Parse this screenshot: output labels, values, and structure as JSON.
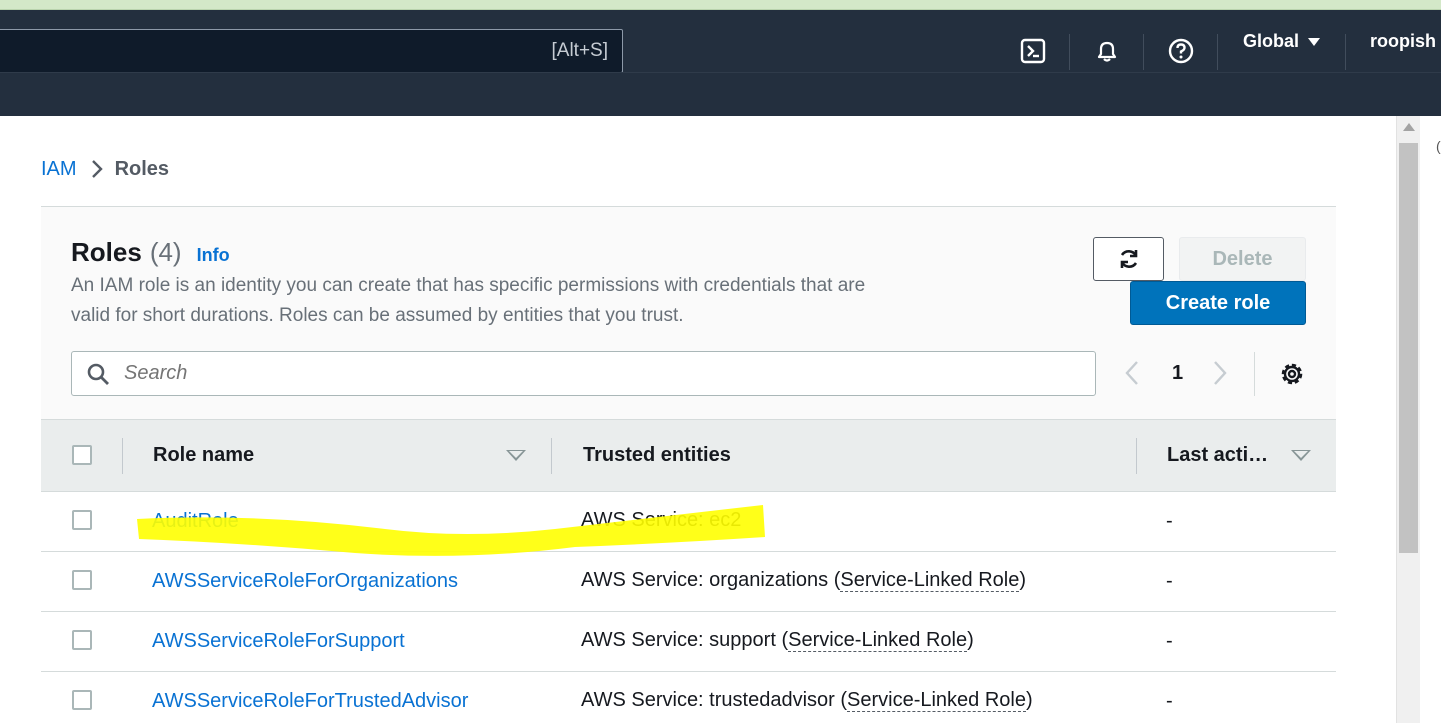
{
  "topnav": {
    "search_shortcut": "[Alt+S]",
    "region": "Global",
    "user": "roopish",
    "icons": [
      "cloudshell-icon",
      "notifications-bell-icon",
      "help-icon"
    ]
  },
  "breadcrumb": {
    "root": "IAM",
    "current": "Roles"
  },
  "roles_panel": {
    "title": "Roles",
    "count": "(4)",
    "info": "Info",
    "description": "An IAM role is an identity you can create that has specific permissions with credentials that are valid for short durations. Roles can be assumed by entities that you trust.",
    "delete_label": "Delete",
    "create_label": "Create role",
    "search_placeholder": "Search",
    "page": "1"
  },
  "table": {
    "columns": [
      "Role name",
      "Trusted entities",
      "Last acti…"
    ],
    "rows": [
      {
        "name": "AuditRole",
        "trust": "AWS Service: ec2",
        "service_linked": "",
        "last": "-"
      },
      {
        "name": "AWSServiceRoleForOrganizations",
        "trust": "AWS Service: organizations (",
        "service_linked": "Service-Linked Role",
        "last": "-"
      },
      {
        "name": "AWSServiceRoleForSupport",
        "trust": "AWS Service: support (",
        "service_linked": "Service-Linked Role",
        "last": "-"
      },
      {
        "name": "AWSServiceRoleForTrustedAdvisor",
        "trust": "AWS Service: trustedadvisor (",
        "service_linked": "Service-Linked Role",
        "last": "-"
      }
    ]
  },
  "colors": {
    "link": "#0972d3",
    "primary_button": "#0073bb",
    "nav_bg": "#232f3e",
    "highlight": "#ffff00"
  }
}
